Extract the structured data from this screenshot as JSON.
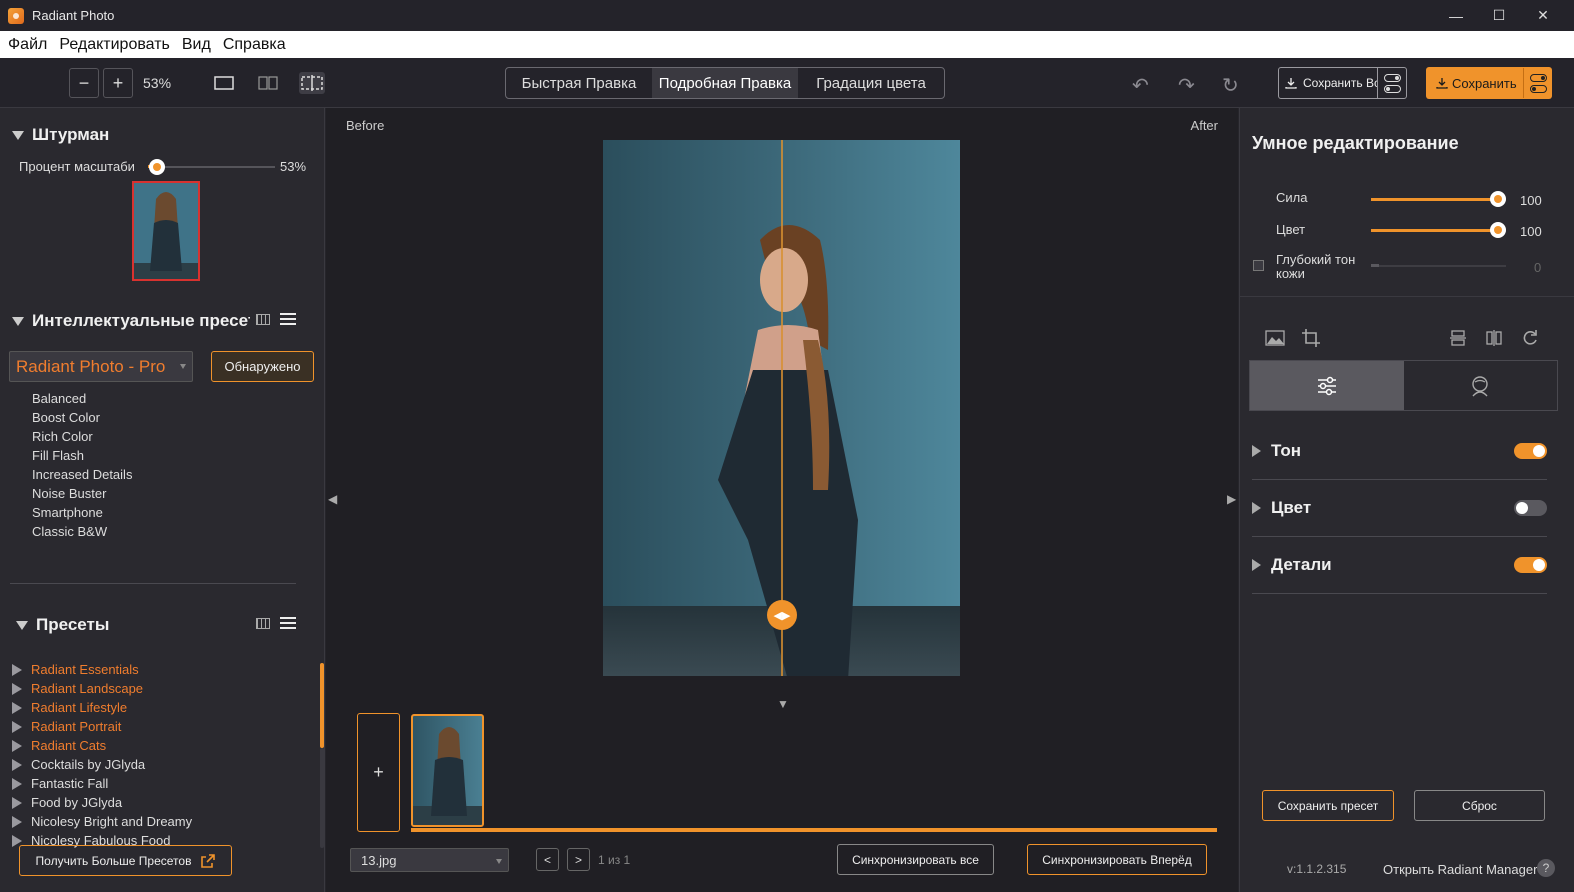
{
  "window": {
    "title": "Radiant Photo",
    "minimize": "—",
    "maximize": "☐",
    "close": "✕"
  },
  "menu": [
    "Файл",
    "Редактировать",
    "Вид",
    "Справка"
  ],
  "toolbar": {
    "zoom_out": "−",
    "zoom_in": "+",
    "zoom_value": "53%",
    "tabs": [
      "Быстрая Правка",
      "Подробная Правка",
      "Градация цвета"
    ],
    "active_tab": "Подробная Правка",
    "undo": "↶",
    "redo": "↷",
    "reset": "↻",
    "save_all_label": "Сохранить Все",
    "save_label": "Сохранить"
  },
  "navigator": {
    "title": "Штурман",
    "zoom_label": "Процент масштабиро",
    "zoom_percent": 53,
    "zoom_value": "53%"
  },
  "smart_presets": {
    "title": "Интеллектуальные пресеты",
    "dropdown_value": "Radiant Photo - Pro",
    "detected_button": "Обнаружено",
    "items": [
      "Balanced",
      "Boost Color",
      "Rich Color",
      "Fill Flash",
      "Increased Details",
      "Noise Buster",
      "Smartphone",
      "Classic B&W"
    ]
  },
  "presets": {
    "title": "Пресеты",
    "categories": [
      {
        "label": "Radiant Essentials",
        "highlight": true
      },
      {
        "label": "Radiant Landscape",
        "highlight": true
      },
      {
        "label": "Radiant Lifestyle",
        "highlight": true
      },
      {
        "label": "Radiant Portrait",
        "highlight": true
      },
      {
        "label": "Radiant Cats",
        "highlight": true
      },
      {
        "label": "Cocktails by JGlyda",
        "highlight": false
      },
      {
        "label": "Fantastic Fall",
        "highlight": false
      },
      {
        "label": "Food by JGlyda",
        "highlight": false
      },
      {
        "label": "Nicolesy Bright and Dreamy",
        "highlight": false
      },
      {
        "label": "Nicolesy Fabulous Food",
        "highlight": false
      }
    ],
    "get_more_button": "Получить Больше Пресетов"
  },
  "canvas": {
    "before_label": "Before",
    "after_label": "After",
    "split_handle": "◀▶",
    "filmstrip_add": "+",
    "file_name": "13.jpg",
    "prev_page": "<",
    "next_page": ">",
    "page_info": "1 из 1",
    "sync_all": "Синхронизировать все",
    "sync_forward": "Синхронизировать Вперёд"
  },
  "smart_edit": {
    "title": "Умное редактирование",
    "sliders": [
      {
        "label": "Сила",
        "value": "100",
        "percent": 100
      },
      {
        "label": "Цвет",
        "value": "100",
        "percent": 100
      },
      {
        "label": "Глубокий тон кожи",
        "value": "0",
        "percent": 0,
        "checkbox": true,
        "enabled": false
      }
    ]
  },
  "adjustments": {
    "sections": [
      {
        "label": "Тон",
        "enabled": true
      },
      {
        "label": "Цвет",
        "enabled": false
      },
      {
        "label": "Детали",
        "enabled": true
      }
    ],
    "save_preset_button": "Сохранить пресет",
    "reset_button": "Сброс"
  },
  "footer": {
    "version": "v:1.1.2.315",
    "manager_link": "Открыть Radiant Manager",
    "help": "?"
  },
  "colors": {
    "accent": "#f0932b",
    "highlight_text": "#f07d2e",
    "panel_bg": "#2a292f",
    "canvas_bg": "#201f24"
  }
}
